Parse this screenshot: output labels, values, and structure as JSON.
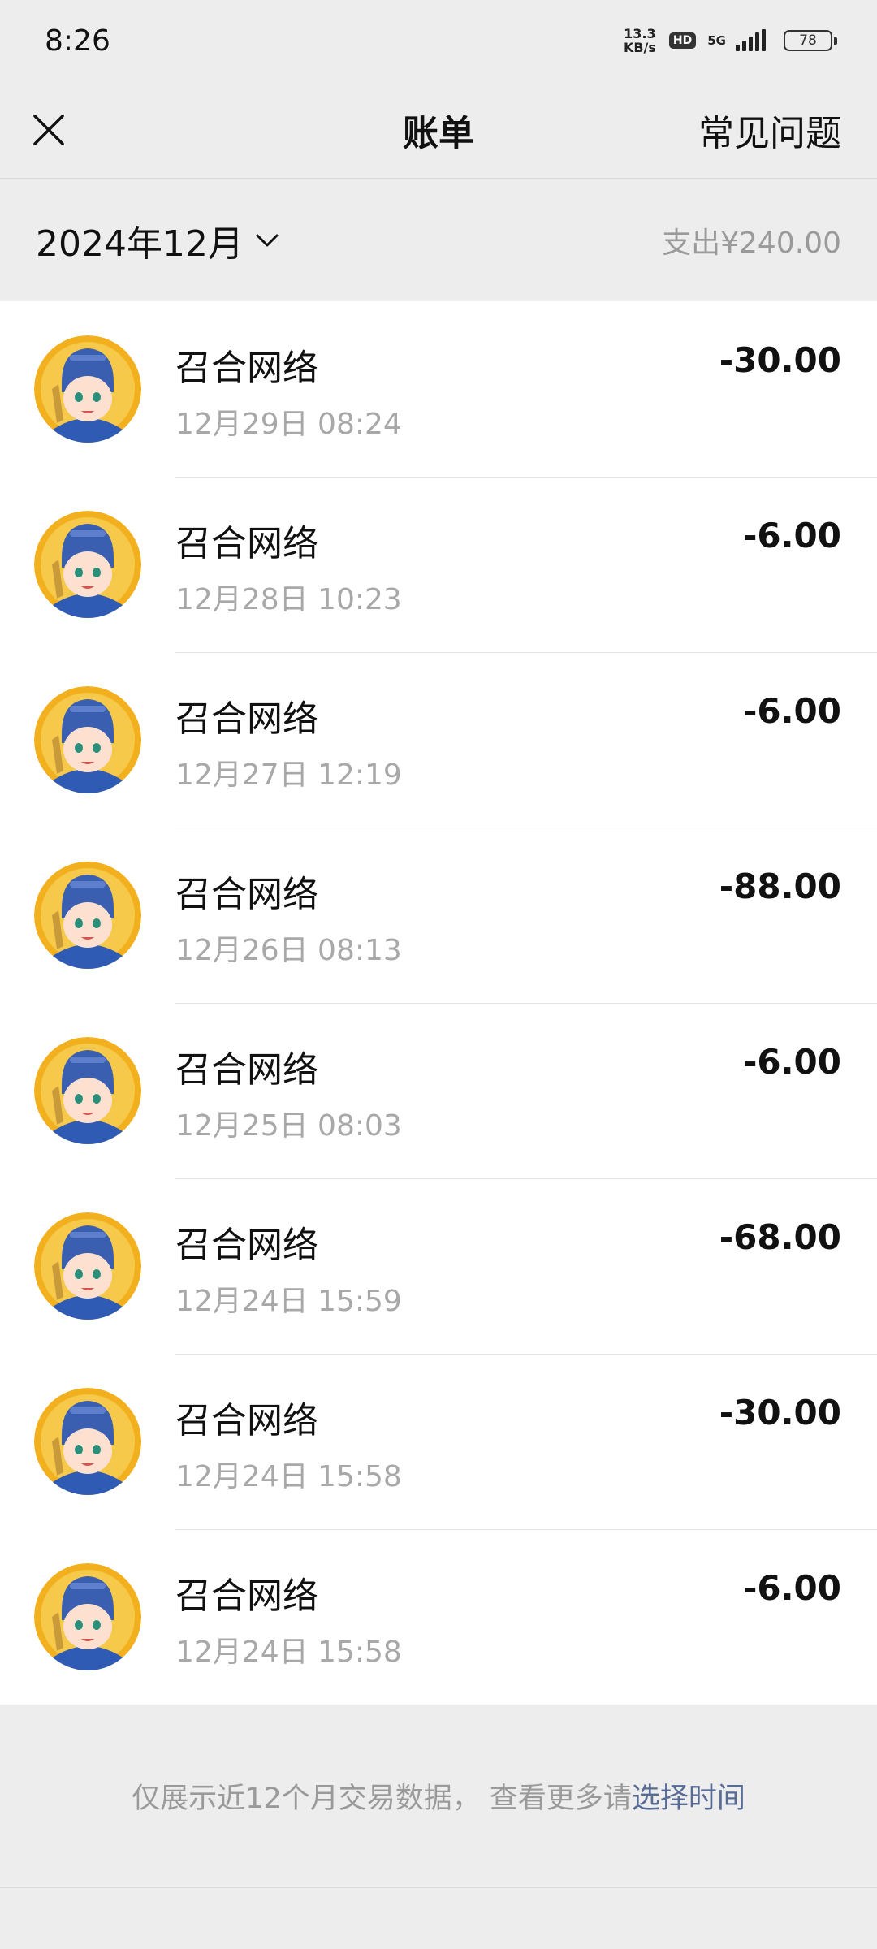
{
  "status_bar": {
    "time": "8:26",
    "net_speed_value": "13.3",
    "net_speed_unit": "KB/s",
    "hd_badge": "HD",
    "net_type": "5G",
    "battery": "78"
  },
  "nav": {
    "close_icon": "close-icon",
    "title": "账单",
    "faq_label": "常见问题"
  },
  "month_bar": {
    "month": "2024年12月",
    "chevron_icon": "chevron-down-icon",
    "spend_total": "支出¥240.00"
  },
  "transactions": [
    {
      "merchant": "召合网络",
      "datetime": "12月29日 08:24",
      "amount": "-30.00"
    },
    {
      "merchant": "召合网络",
      "datetime": "12月28日 10:23",
      "amount": "-6.00"
    },
    {
      "merchant": "召合网络",
      "datetime": "12月27日 12:19",
      "amount": "-6.00"
    },
    {
      "merchant": "召合网络",
      "datetime": "12月26日 08:13",
      "amount": "-88.00"
    },
    {
      "merchant": "召合网络",
      "datetime": "12月25日 08:03",
      "amount": "-6.00"
    },
    {
      "merchant": "召合网络",
      "datetime": "12月24日 15:59",
      "amount": "-68.00"
    },
    {
      "merchant": "召合网络",
      "datetime": "12月24日 15:58",
      "amount": "-30.00"
    },
    {
      "merchant": "召合网络",
      "datetime": "12月24日 15:58",
      "amount": "-6.00"
    }
  ],
  "footer": {
    "text": "仅展示近12个月交易数据， 查看更多请",
    "link": "选择时间"
  },
  "colors": {
    "page_bg": "#ededed",
    "link_blue": "#576b95",
    "muted_gray": "#a8a8a8",
    "avatar_ring": "#f2b01e",
    "helmet_blue": "#3a5fb0"
  }
}
